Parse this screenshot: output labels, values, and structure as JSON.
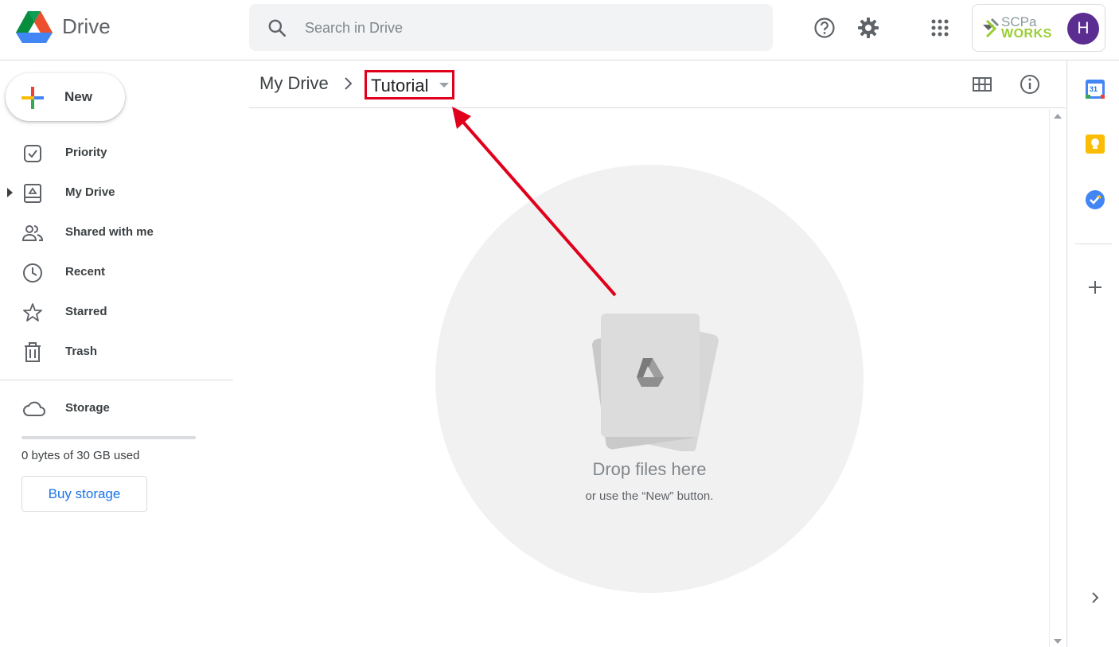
{
  "header": {
    "app_name": "Drive",
    "search_placeholder": "Search in Drive",
    "org_logo_top": "SCPa",
    "org_logo_bottom": "WORKS",
    "avatar_initial": "H"
  },
  "sidebar": {
    "new_label": "New",
    "items": [
      {
        "label": "Priority",
        "icon": "priority-icon"
      },
      {
        "label": "My Drive",
        "icon": "my-drive-icon"
      },
      {
        "label": "Shared with me",
        "icon": "shared-icon"
      },
      {
        "label": "Recent",
        "icon": "clock-icon"
      },
      {
        "label": "Starred",
        "icon": "star-icon"
      },
      {
        "label": "Trash",
        "icon": "trash-icon"
      }
    ],
    "storage_label": "Storage",
    "storage_used": "0 bytes of 30 GB used",
    "storage_fraction": 0,
    "buy_storage_label": "Buy storage"
  },
  "breadcrumb": {
    "root": "My Drive",
    "current": "Tutorial"
  },
  "empty_state": {
    "title": "Drop files here",
    "subtitle": "or use the “New” button."
  },
  "side_panel": {
    "calendar_day": "31"
  },
  "colors": {
    "accent": "#1a73e8",
    "highlight_box": "#e0001b",
    "avatar": "#5c2d91"
  }
}
